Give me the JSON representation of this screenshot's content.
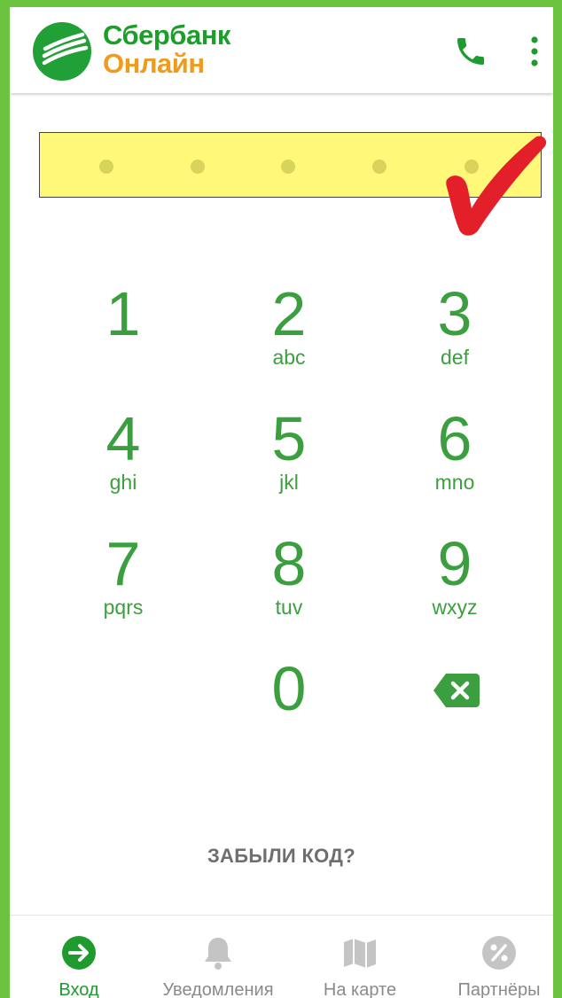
{
  "header": {
    "brand_line1": "Сбербанк",
    "brand_line2": "Онлайн",
    "icons": [
      "sberbank-logo-icon",
      "phone-icon",
      "more-vertical-icon"
    ]
  },
  "pin": {
    "length": 5,
    "filled": 0
  },
  "keypad": [
    {
      "digit": "1",
      "letters": ""
    },
    {
      "digit": "2",
      "letters": "abc"
    },
    {
      "digit": "3",
      "letters": "def"
    },
    {
      "digit": "4",
      "letters": "ghi"
    },
    {
      "digit": "5",
      "letters": "jkl"
    },
    {
      "digit": "6",
      "letters": "mno"
    },
    {
      "digit": "7",
      "letters": "pqrs"
    },
    {
      "digit": "8",
      "letters": "tuv"
    },
    {
      "digit": "9",
      "letters": "wxyz"
    },
    {
      "digit": "0",
      "letters": ""
    }
  ],
  "forgot_label": "ЗАБЫЛИ КОД?",
  "bottom_nav": [
    {
      "label": "Вход",
      "icon": "login-arrow-icon",
      "active": true
    },
    {
      "label": "Уведомления",
      "icon": "bell-icon",
      "active": false
    },
    {
      "label": "На карте",
      "icon": "map-icon",
      "active": false
    },
    {
      "label": "Партнёры",
      "icon": "percent-icon",
      "active": false
    }
  ],
  "colors": {
    "frame": "#6bc33f",
    "brand_green": "#1a9f29",
    "brand_orange": "#f09b1b",
    "key_green": "#3c9f3f",
    "pin_highlight": "#fff878",
    "checkmark_red": "#e3202a"
  }
}
